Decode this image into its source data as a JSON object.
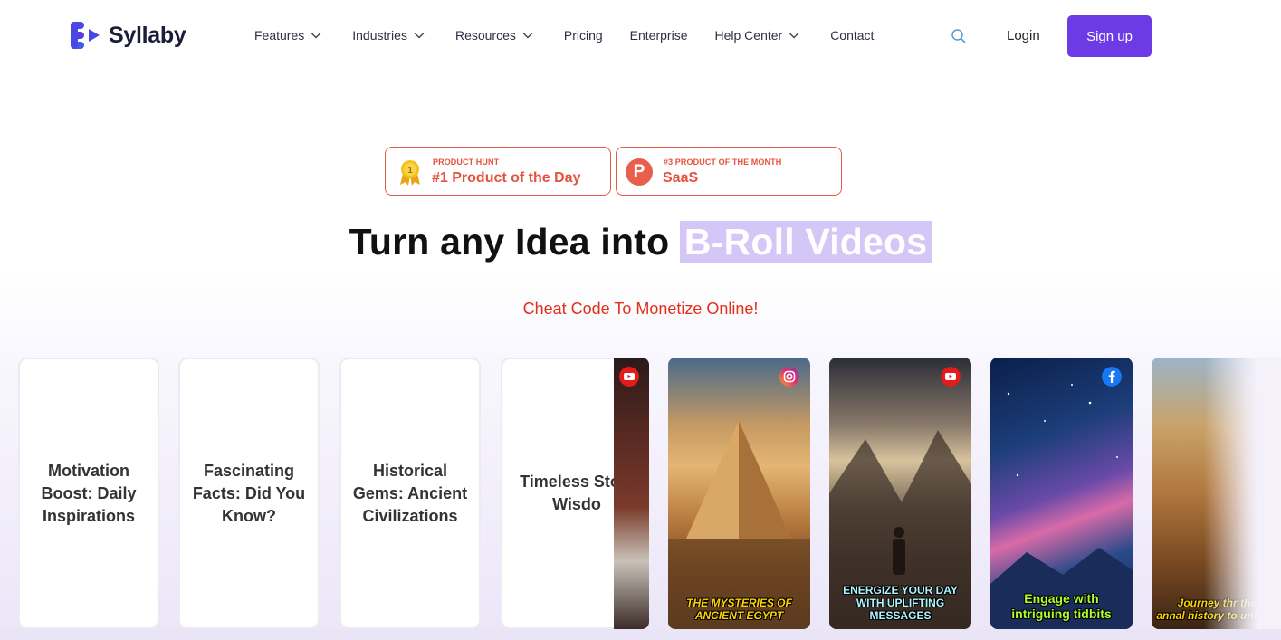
{
  "brand": {
    "name": "Syllaby"
  },
  "nav": {
    "items": [
      {
        "label": "Features",
        "dropdown": true
      },
      {
        "label": "Industries",
        "dropdown": true
      },
      {
        "label": "Resources",
        "dropdown": true
      },
      {
        "label": "Pricing",
        "dropdown": false
      },
      {
        "label": "Enterprise",
        "dropdown": false
      },
      {
        "label": "Help Center",
        "dropdown": true
      },
      {
        "label": "Contact",
        "dropdown": false
      }
    ],
    "login": "Login",
    "signup": "Sign up"
  },
  "badges": [
    {
      "small": "PRODUCT HUNT",
      "big": "#1 Product of the Day",
      "icon": "medal-icon"
    },
    {
      "small": "#3 PRODUCT OF THE MONTH",
      "big": "SaaS",
      "icon": "producthunt-logo-icon",
      "logo_letter": "P"
    }
  ],
  "hero": {
    "title_prefix": "Turn any Idea into",
    "title_highlight": "B-Roll Videos",
    "tagline": "Cheat Code To Monetize Online!"
  },
  "topic_cards": [
    "Motivation Boost: Daily Inspirations",
    "Fascinating Facts: Did You Know?",
    "Historical Gems: Ancient Civilizations",
    "Timeless Stoic Wisdo"
  ],
  "video_cards": [
    {
      "caption": "",
      "platform": "youtube-icon"
    },
    {
      "caption": "THE MYSTERIES OF ANCIENT EGYPT",
      "platform": "instagram-icon"
    },
    {
      "caption": "ENERGIZE YOUR DAY WITH UPLIFTING MESSAGES",
      "platform": "youtube-icon"
    },
    {
      "caption": "Engage with intriguing tidbits",
      "platform": "facebook-icon"
    },
    {
      "caption": "Journey thr the annal history to unl",
      "platform": ""
    }
  ],
  "colors": {
    "accent": "#6d3be6",
    "badge": "#e4533d",
    "tagline": "#e0301c",
    "highlight": "#d4c6f7"
  }
}
